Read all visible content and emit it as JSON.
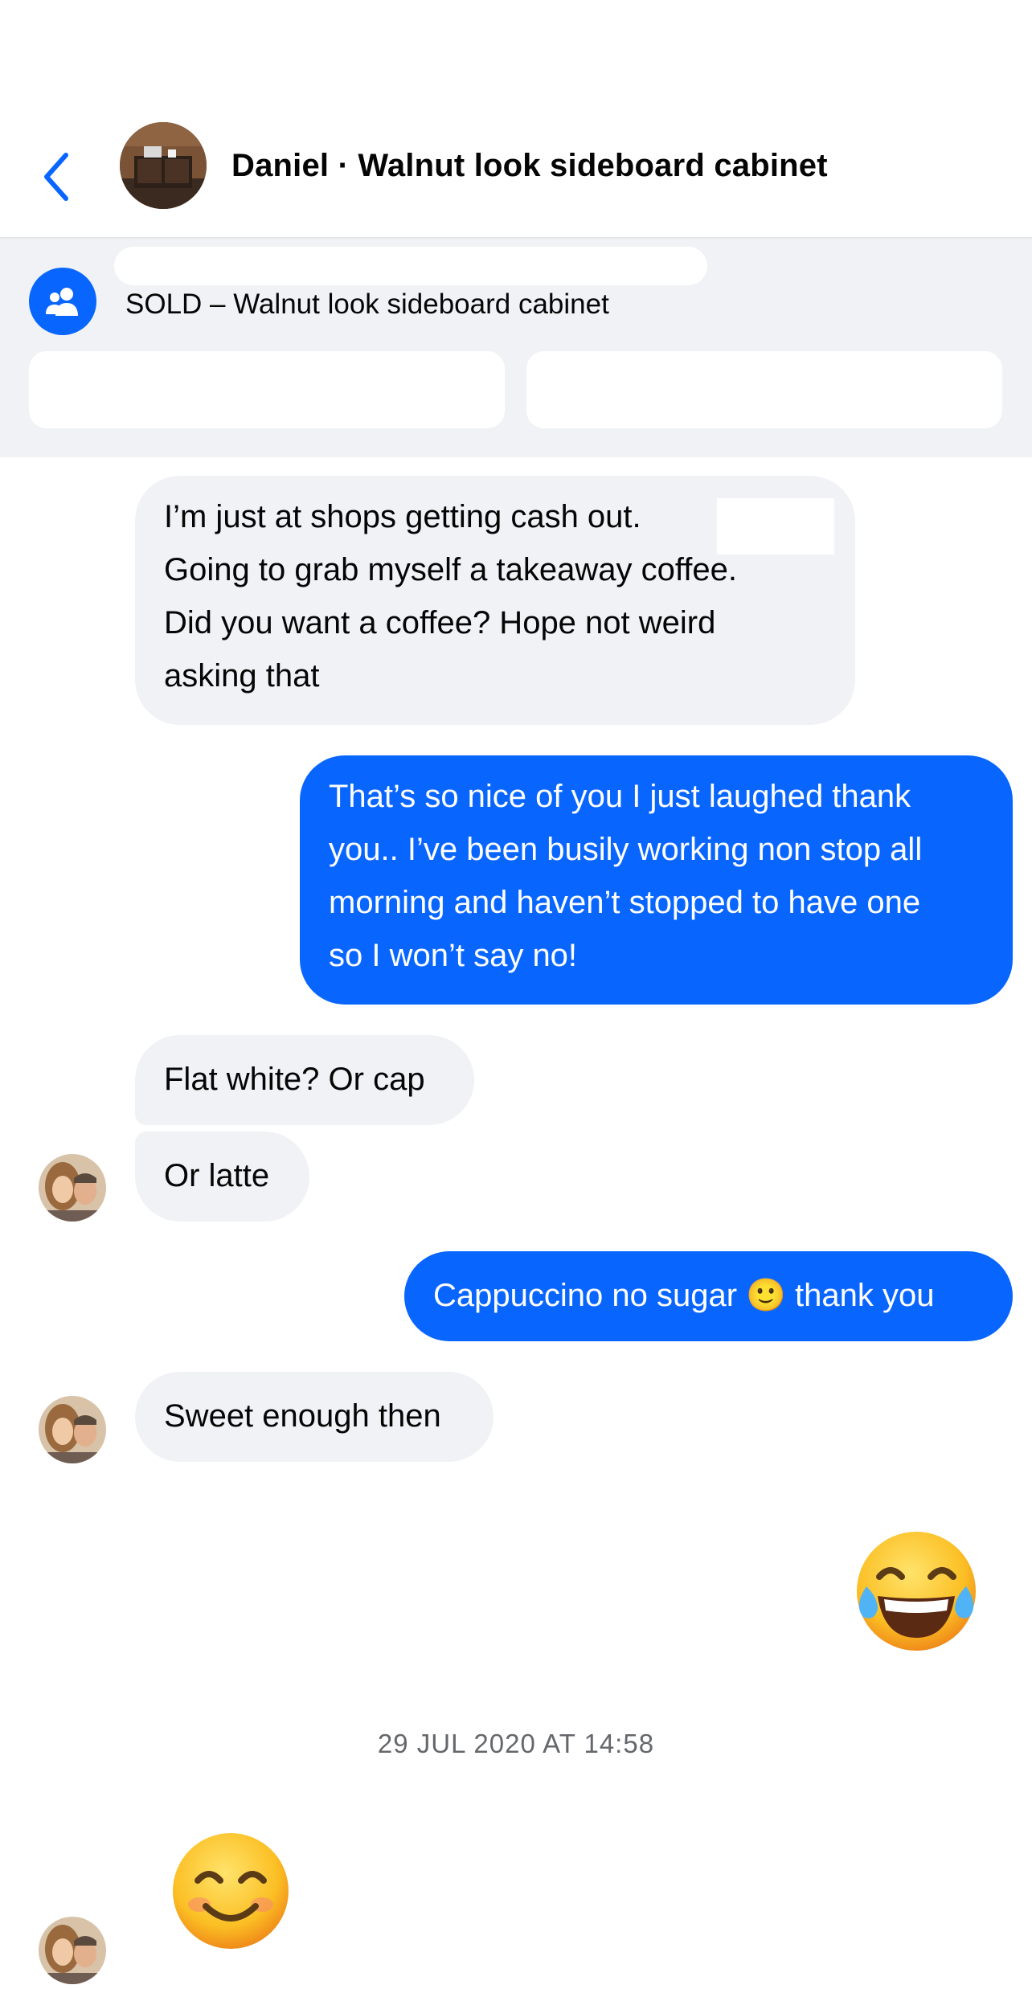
{
  "header": {
    "back_icon": "chevron-left-icon",
    "title": "Daniel · Walnut look sideboard cabinet"
  },
  "listing": {
    "icon": "group-icon",
    "title": "SOLD – Walnut look sideboard cabinet"
  },
  "messages": [
    {
      "direction": "in",
      "lines": [
        "I’m just at  shops getting cash out.",
        "Going to grab myself a takeaway coffee.",
        "Did you want a coffee? Hope not weird",
        "asking that"
      ]
    },
    {
      "direction": "out",
      "lines": [
        "That’s so nice of you I just laughed thank",
        "you.. I’ve been  busily working non stop all",
        "morning and haven’t stopped to have one",
        "so I won’t say no!"
      ]
    },
    {
      "direction": "in",
      "text": "Flat white? Or cap"
    },
    {
      "direction": "in",
      "text": "Or latte"
    },
    {
      "direction": "out",
      "text": "Cappuccino no sugar 🙂 thank you"
    },
    {
      "direction": "in",
      "text": "Sweet enough then"
    },
    {
      "direction": "out",
      "emoji": "😂"
    },
    {
      "direction": "in",
      "emoji": "😊"
    }
  ],
  "timestamp": "29 JUL 2020 AT 14:58",
  "colors": {
    "accent": "#0866ff",
    "incoming_bubble": "#f0f2f5",
    "timestamp": "#65676b"
  }
}
